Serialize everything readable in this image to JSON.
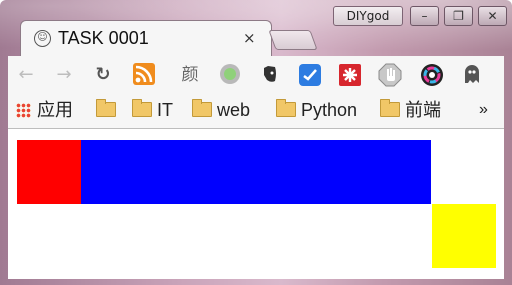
{
  "window": {
    "profile_label": "DIYgod",
    "controls": [
      "–",
      "❐",
      "✕"
    ]
  },
  "tab": {
    "title": "TASK 0001",
    "close": "×"
  },
  "toolbar": {
    "back": "←",
    "forward": "→",
    "reload": "↻",
    "extensions": [
      "rss-icon",
      "yan-icon",
      "green-dot-icon",
      "evernote-icon",
      "blue-check-icon",
      "red-star-icon",
      "hand-icon",
      "color-wheel-icon",
      "ghost-icon"
    ],
    "yan_label": "颜"
  },
  "bookmarks": {
    "apps_label": "应用",
    "items": [
      "",
      "IT",
      "web",
      "Python",
      "前端"
    ],
    "more": "»"
  },
  "content": {
    "colors": {
      "red": "#ff0000",
      "blue": "#0000ff",
      "yellow": "#ffff00"
    }
  }
}
